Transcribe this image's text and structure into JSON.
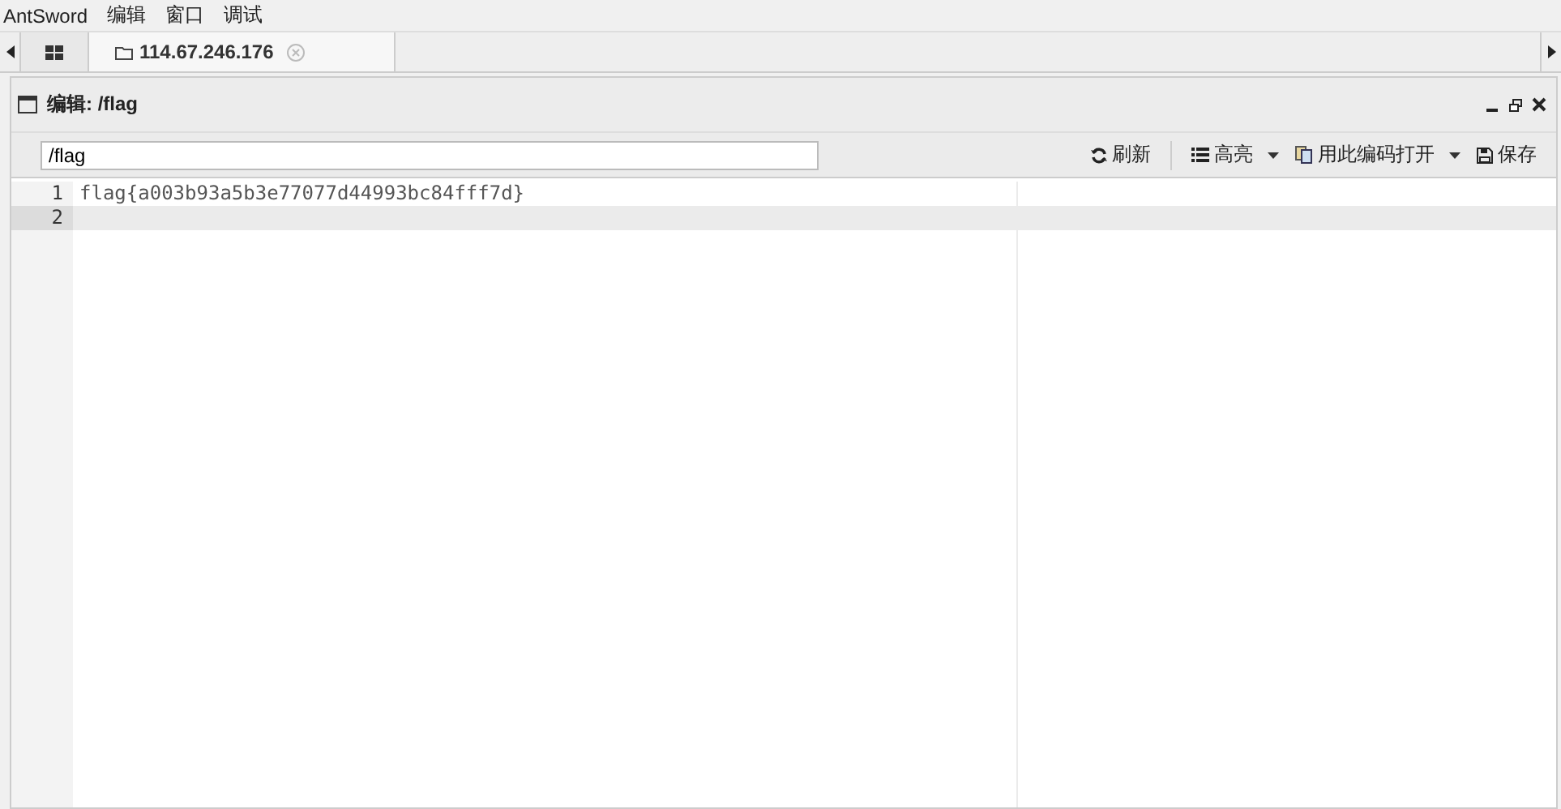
{
  "menu": [
    "AntSword",
    "编辑",
    "窗口",
    "调试"
  ],
  "tabs": [
    {
      "kind": "home",
      "selected": false
    },
    {
      "kind": "folder",
      "label": "114.67.246.176",
      "selected": true
    }
  ],
  "panel": {
    "title": "编辑: /flag"
  },
  "path_field": {
    "value": "/flag"
  },
  "toolbar": [
    {
      "kind": "refresh",
      "label": "刷新",
      "dropdown": false
    },
    {
      "kind": "list",
      "label": "高亮",
      "dropdown": true
    },
    {
      "kind": "encoding",
      "label": "用此编码打开",
      "dropdown": true
    },
    {
      "kind": "save",
      "label": "保存",
      "dropdown": false
    }
  ],
  "editor": {
    "lines": [
      {
        "number": "1",
        "text": "flag{a003b93a5b3e77077d44993bc84fff7d}",
        "active": false
      },
      {
        "number": "2",
        "active": true
      }
    ]
  }
}
